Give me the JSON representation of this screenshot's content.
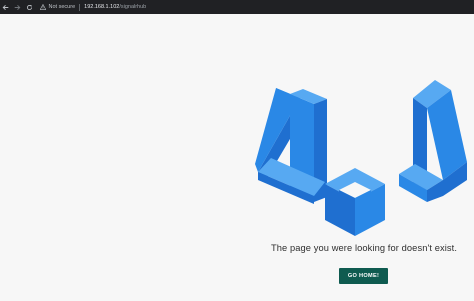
{
  "browser": {
    "security_label": "Not secure",
    "url_host": "192.168.1.102",
    "url_path": "/signalrhub"
  },
  "page": {
    "message": "The page you were looking for doesn't exist.",
    "home_button_label": "GO HOME!",
    "button_color": "#0f5b50",
    "logo_colors": [
      "#1f6fd0",
      "#2a88e6",
      "#57a9f2"
    ]
  }
}
